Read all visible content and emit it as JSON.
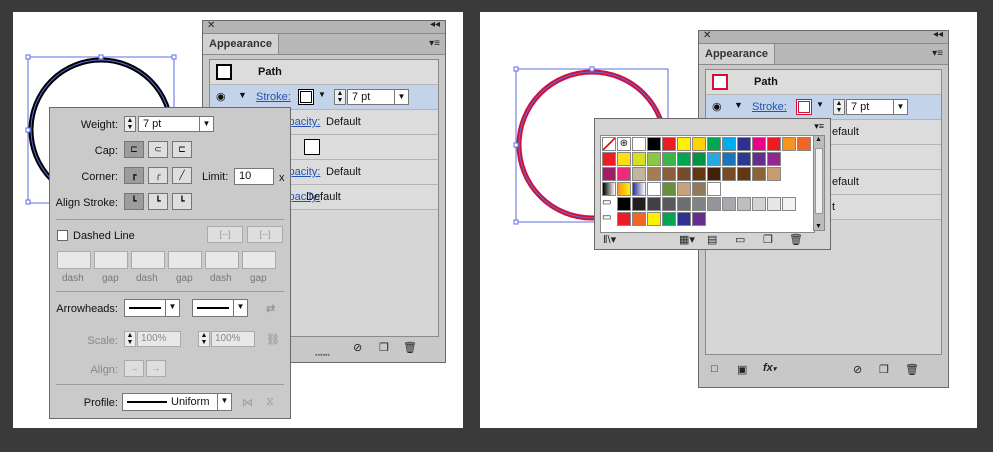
{
  "left": {
    "appearance": {
      "tab": "Appearance",
      "object_label": "Path",
      "stroke_link": "Stroke:",
      "stroke_weight": "7 pt",
      "rows": [
        {
          "label": "Opacity:",
          "value": "Default"
        },
        {
          "label": "Opacity:",
          "value": "Default"
        },
        {
          "label": "Opacity:",
          "value": "Default"
        }
      ]
    },
    "stroke_panel": {
      "weight_label": "Weight:",
      "weight_value": "7 pt",
      "cap_label": "Cap:",
      "corner_label": "Corner:",
      "limit_label": "Limit:",
      "limit_value": "10",
      "limit_unit": "x",
      "align_label": "Align Stroke:",
      "dashed_label": "Dashed Line",
      "dash_labels": [
        "dash",
        "gap",
        "dash",
        "gap",
        "dash",
        "gap"
      ],
      "arrowheads_label": "Arrowheads:",
      "scale_label": "Scale:",
      "scale_a": "100%",
      "scale_b": "100%",
      "align_arrow_label": "Align:",
      "profile_label": "Profile:",
      "profile_value": "Uniform"
    }
  },
  "right": {
    "appearance": {
      "tab": "Appearance",
      "object_label": "Path",
      "stroke_link": "Stroke:",
      "stroke_weight": "7 pt",
      "rows": [
        {
          "value": "efault"
        },
        {
          "value": "efault"
        },
        {
          "value": "t"
        }
      ],
      "fx_label": "fx"
    },
    "swatches": {
      "row1": [
        "#ffffff",
        "#000000",
        "#ec1c24",
        "#fff200",
        "#ffd400",
        "#00a651",
        "#00aeef",
        "#2e3192",
        "#ec008c",
        "#ed1c24",
        "#f7941d",
        "#f26522"
      ],
      "row2": [
        "#ed1c24",
        "#ffde17",
        "#d7df23",
        "#8dc63f",
        "#39b54a",
        "#00a651",
        "#009444",
        "#27aae1",
        "#1c75bc",
        "#2b3990",
        "#662d91",
        "#92278f"
      ],
      "row3": [
        "#9e1f63",
        "#ee2a7b",
        "#c2b59b",
        "#a67c52",
        "#8b5e3c",
        "#754c29",
        "#603913",
        "#42210b",
        "#754c24",
        "#603813",
        "#8c6239",
        "#c69c6d"
      ],
      "row5": [
        "#000000",
        "#231f20",
        "#414042",
        "#58595b",
        "#6d6e71",
        "#808285",
        "#939598",
        "#a7a9ac",
        "#bcbec0",
        "#d1d3d4",
        "#e6e7e8",
        "#f1f2f2"
      ],
      "row6": [
        "#ed1c24",
        "#f26522",
        "#fff200",
        "#00a651",
        "#2e3192",
        "#662d91"
      ]
    }
  },
  "colors": {
    "stroke_black": "#000000",
    "stroke_red": "#d0103a",
    "selection_blue": "#5b6ee0"
  }
}
